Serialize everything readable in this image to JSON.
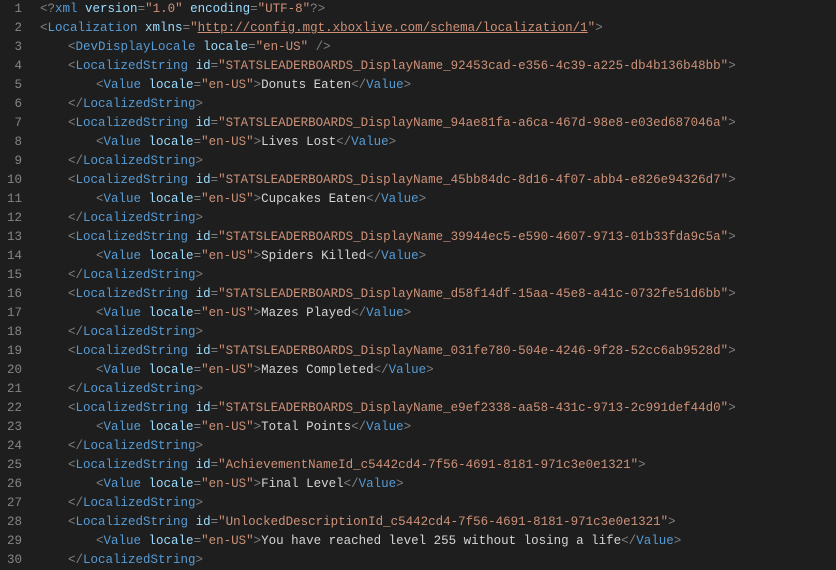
{
  "xml_decl": {
    "version": "1.0",
    "encoding": "UTF-8"
  },
  "root": {
    "name": "Localization",
    "xmlns": "http://config.mgt.xboxlive.com/schema/localization/1",
    "devDisplayLocale": "en-US"
  },
  "entries": [
    {
      "kind": "LocalizedString",
      "id": "STATSLEADERBOARDS_DisplayName_92453cad-e356-4c39-a225-db4b136b48bb",
      "locale": "en-US",
      "value": "Donuts Eaten"
    },
    {
      "kind": "LocalizedString",
      "id": "STATSLEADERBOARDS_DisplayName_94ae81fa-a6ca-467d-98e8-e03ed687046a",
      "locale": "en-US",
      "value": "Lives Lost"
    },
    {
      "kind": "LocalizedString",
      "id": "STATSLEADERBOARDS_DisplayName_45bb84dc-8d16-4f07-abb4-e826e94326d7",
      "locale": "en-US",
      "value": "Cupcakes Eaten"
    },
    {
      "kind": "LocalizedString",
      "id": "STATSLEADERBOARDS_DisplayName_39944ec5-e590-4607-9713-01b33fda9c5a",
      "locale": "en-US",
      "value": "Spiders Killed"
    },
    {
      "kind": "LocalizedString",
      "id": "STATSLEADERBOARDS_DisplayName_d58f14df-15aa-45e8-a41c-0732fe51d6bb",
      "locale": "en-US",
      "value": "Mazes Played"
    },
    {
      "kind": "LocalizedString",
      "id": "STATSLEADERBOARDS_DisplayName_031fe780-504e-4246-9f28-52cc6ab9528d",
      "locale": "en-US",
      "value": "Mazes Completed"
    },
    {
      "kind": "LocalizedString",
      "id": "STATSLEADERBOARDS_DisplayName_e9ef2338-aa58-431c-9713-2c991def44d0",
      "locale": "en-US",
      "value": "Total Points"
    },
    {
      "kind": "LocalizedString",
      "id": "AchievementNameId_c5442cd4-7f56-4691-8181-971c3e0e1321",
      "locale": "en-US",
      "value": "Final Level"
    },
    {
      "kind": "LocalizedString",
      "id": "UnlockedDescriptionId_c5442cd4-7f56-4691-8181-971c3e0e1321",
      "locale": "en-US",
      "value": "You have reached level 255 without losing a life"
    }
  ],
  "first_line_number": 1
}
